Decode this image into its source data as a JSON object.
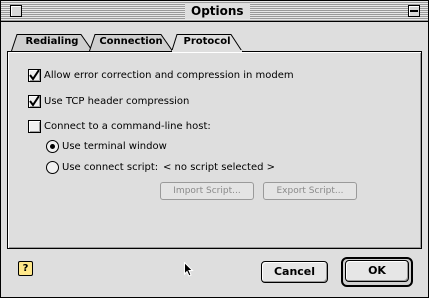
{
  "window": {
    "title": "Options"
  },
  "tabs": [
    {
      "label": "Redialing",
      "selected": false
    },
    {
      "label": "Connection",
      "selected": false
    },
    {
      "label": "Protocol",
      "selected": true
    }
  ],
  "options": {
    "error_correction": {
      "label": "Allow error correction and compression in modem",
      "checked": true
    },
    "tcp_header": {
      "label": "Use TCP header compression",
      "checked": true
    },
    "command_line_host": {
      "label": "Connect to a command-line host:",
      "checked": false
    }
  },
  "host_mode": {
    "terminal": {
      "label": "Use terminal window",
      "selected": true
    },
    "script": {
      "label": "Use connect script:",
      "value": "< no script selected >",
      "selected": false
    }
  },
  "script_buttons": {
    "import": "Import Script...",
    "export": "Export Script..."
  },
  "footer": {
    "help_glyph": "?",
    "cancel": "Cancel",
    "ok": "OK"
  },
  "icons": [
    "close-box-icon",
    "collapse-box-icon",
    "checkmark-icon",
    "help-icon",
    "arrow-cursor-icon"
  ]
}
